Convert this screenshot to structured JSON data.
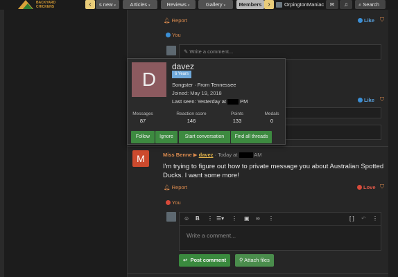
{
  "nav": {
    "items": [
      {
        "label": "s new",
        "active": false
      },
      {
        "label": "Articles",
        "active": false
      },
      {
        "label": "Reviews",
        "active": false
      },
      {
        "label": "Gallery",
        "active": false
      },
      {
        "label": "Members",
        "active": true
      }
    ],
    "dropdown_glyph": "▾",
    "prev_glyph": "‹",
    "next_glyph": "›",
    "username": "OrpingtonManiac",
    "search_label": "Search",
    "logo_text_line1": "BACKYARD",
    "logo_text_line2": "CHICKENS"
  },
  "post_top": {
    "report": "Report",
    "like": "Like",
    "reaction": "You",
    "comment_placeholder": "Write a comment..."
  },
  "post_mid": {
    "like": "Like"
  },
  "message": {
    "avatar_letter": "M",
    "author": "Miss Benne",
    "mention": "davez",
    "time_prefix": "Today at",
    "time_suffix": "AM",
    "body": "I'm trying to figure out how to private message you about Australian Spotted Ducks. I want some more!",
    "report": "Report",
    "love": "Love",
    "reaction": "You"
  },
  "editor": {
    "placeholder": "Write a comment...",
    "post_button": "Post comment",
    "attach_button": "Attach files"
  },
  "member_card": {
    "avatar_letter": "D",
    "name": "davez",
    "badge": "6 Years",
    "title": "Songster · From Tennessee",
    "joined": "Joined: May 19, 2018",
    "last_seen_prefix": "Last seen: Yesterday at",
    "last_seen_suffix": "PM",
    "stats": [
      {
        "label": "Messages",
        "value": "87"
      },
      {
        "label": "Reaction score",
        "value": "146"
      },
      {
        "label": "Points",
        "value": "133"
      },
      {
        "label": "Medals",
        "value": "0"
      }
    ],
    "actions": [
      "Follow",
      "Ignore",
      "Start conversation",
      "Find all threads"
    ]
  },
  "colors": {
    "accent_orange": "#d98a4e",
    "like_blue": "#5aa3e0",
    "button_green": "#3a8a3e",
    "nav_active": "#b8b8b8"
  }
}
